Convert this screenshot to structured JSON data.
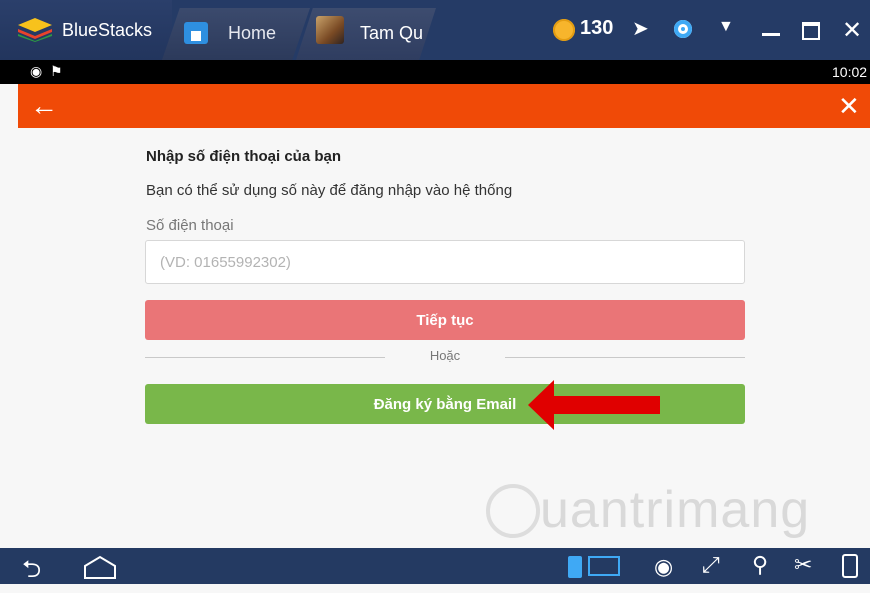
{
  "titlebar": {
    "app_name": "BlueStacks",
    "home_tab": "Home",
    "game_tab": "Tam Qu",
    "coins": "130"
  },
  "statusbar": {
    "time": "10:02"
  },
  "form": {
    "title": "Nhập số điện thoại của bạn",
    "description": "Bạn có thể sử dụng số này để đăng nhập vào hệ thống",
    "phone_label": "Số điện thoại",
    "phone_placeholder": "(VD: 01655992302)",
    "phone_value": "",
    "continue_label": "Tiếp tục",
    "or_label": "Hoặc",
    "email_label": "Đăng ký bằng Email"
  },
  "watermark": {
    "text": "uantrimang"
  },
  "colors": {
    "header": "#f04a07",
    "continue_button": "#ea7577",
    "email_button": "#79b74a",
    "arrow": "#e00000"
  },
  "icons": [
    "bluestacks-logo-icon",
    "home-icon",
    "game-thumbnail-icon",
    "coin-icon",
    "pin-icon",
    "location-icon",
    "dropdown-icon",
    "minimize-icon",
    "maximize-icon",
    "close-icon",
    "back-arrow-icon",
    "close-x-icon",
    "back-icon",
    "home-nav-icon",
    "keyboard-icon",
    "eye-icon",
    "expand-icon",
    "location-pin-icon",
    "scissors-icon",
    "phone-rotate-icon"
  ]
}
